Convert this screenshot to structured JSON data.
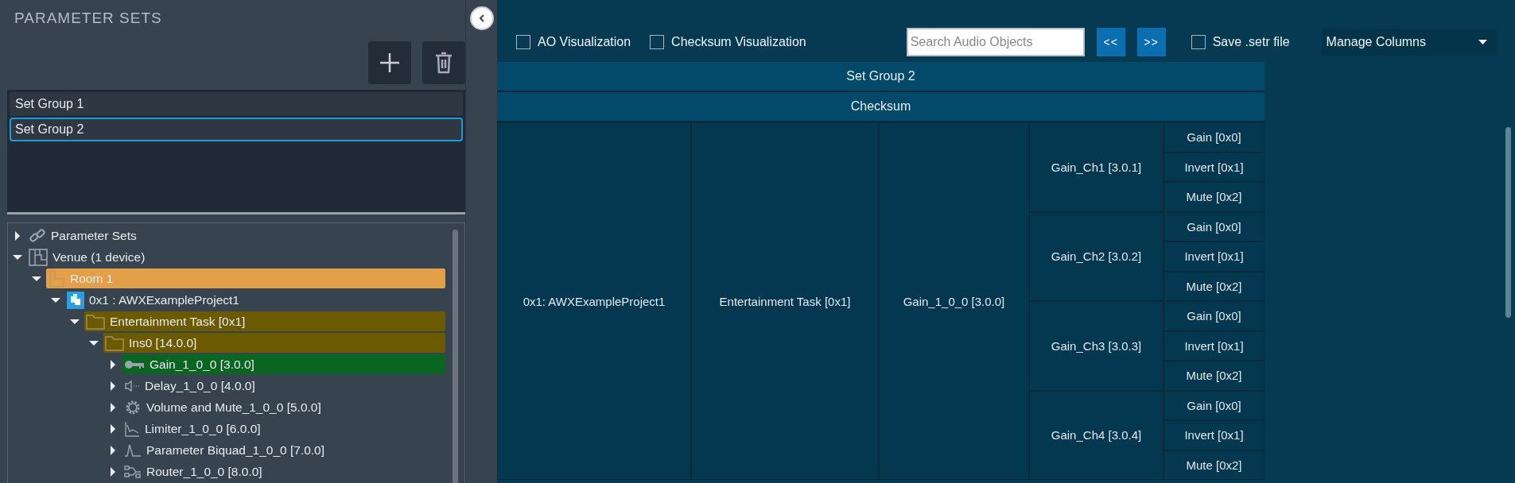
{
  "sidebar": {
    "title": "PARAMETER SETS",
    "set_groups": [
      {
        "label": "Set Group 1",
        "selected": false
      },
      {
        "label": "Set Group 2",
        "selected": true
      }
    ]
  },
  "tree": {
    "items": [
      {
        "label": "Parameter Sets",
        "kind": "link",
        "expanded": false
      },
      {
        "label": "Venue (1 device)",
        "kind": "venue",
        "expanded": true,
        "children": [
          {
            "label": "Room 1",
            "kind": "room",
            "expanded": true,
            "color": "#e4a048",
            "children": [
              {
                "label": "0x1 : AWXExampleProject1",
                "kind": "device",
                "expanded": true,
                "children": [
                  {
                    "label": "Entertainment Task [0x1]",
                    "kind": "folder",
                    "expanded": true,
                    "color": "#6b5a00",
                    "children": [
                      {
                        "label": "Ins0 [14.0.0]",
                        "kind": "folder",
                        "expanded": true,
                        "color": "#6b5a00",
                        "children": [
                          {
                            "label": "Gain_1_0_0 [3.0.0]",
                            "kind": "key",
                            "expanded": false,
                            "color": "#0a6422"
                          },
                          {
                            "label": "Delay_1_0_0 [4.0.0]",
                            "kind": "speaker",
                            "expanded": false
                          },
                          {
                            "label": "Volume and Mute_1_0_0 [5.0.0]",
                            "kind": "gear",
                            "expanded": false
                          },
                          {
                            "label": "Limiter_1_0_0 [6.0.0]",
                            "kind": "chart",
                            "expanded": false
                          },
                          {
                            "label": "Parameter Biquad_1_0_0 [7.0.0]",
                            "kind": "wave",
                            "expanded": false
                          },
                          {
                            "label": "Router_1_0_0 [8.0.0]",
                            "kind": "router",
                            "expanded": false
                          }
                        ]
                      }
                    ]
                  }
                ]
              }
            ]
          }
        ]
      }
    ]
  },
  "toolbar": {
    "checkboxes": [
      {
        "label": "AO Visualization",
        "checked": false
      },
      {
        "label": "Checksum Visualization",
        "checked": false
      }
    ],
    "search": {
      "placeholder": "Search Audio Objects"
    },
    "prev_button": "<<",
    "next_button": ">>",
    "save_checkbox": {
      "label": "Save .setr file",
      "checked": false
    },
    "columns_dropdown": "Manage Columns"
  },
  "table": {
    "group_header": "Set Group 2",
    "checksum_header": "Checksum",
    "device": "0x1: AWXExampleProject1",
    "task": "Entertainment Task [0x1]",
    "object": "Gain_1_0_0 [3.0.0]",
    "channels": [
      {
        "name": "Gain_Ch1 [3.0.1]",
        "parameters": [
          "Gain [0x0]",
          "Invert [0x1]",
          "Mute [0x2]"
        ]
      },
      {
        "name": "Gain_Ch2 [3.0.2]",
        "parameters": [
          "Gain [0x0]",
          "Invert [0x1]",
          "Mute [0x2]"
        ]
      },
      {
        "name": "Gain_Ch3 [3.0.3]",
        "parameters": [
          "Gain [0x0]",
          "Invert [0x1]",
          "Mute [0x2]"
        ]
      },
      {
        "name": "Gain_Ch4 [3.0.4]",
        "parameters": [
          "Gain [0x0]",
          "Invert [0x1]",
          "Mute [0x2]"
        ]
      }
    ]
  }
}
